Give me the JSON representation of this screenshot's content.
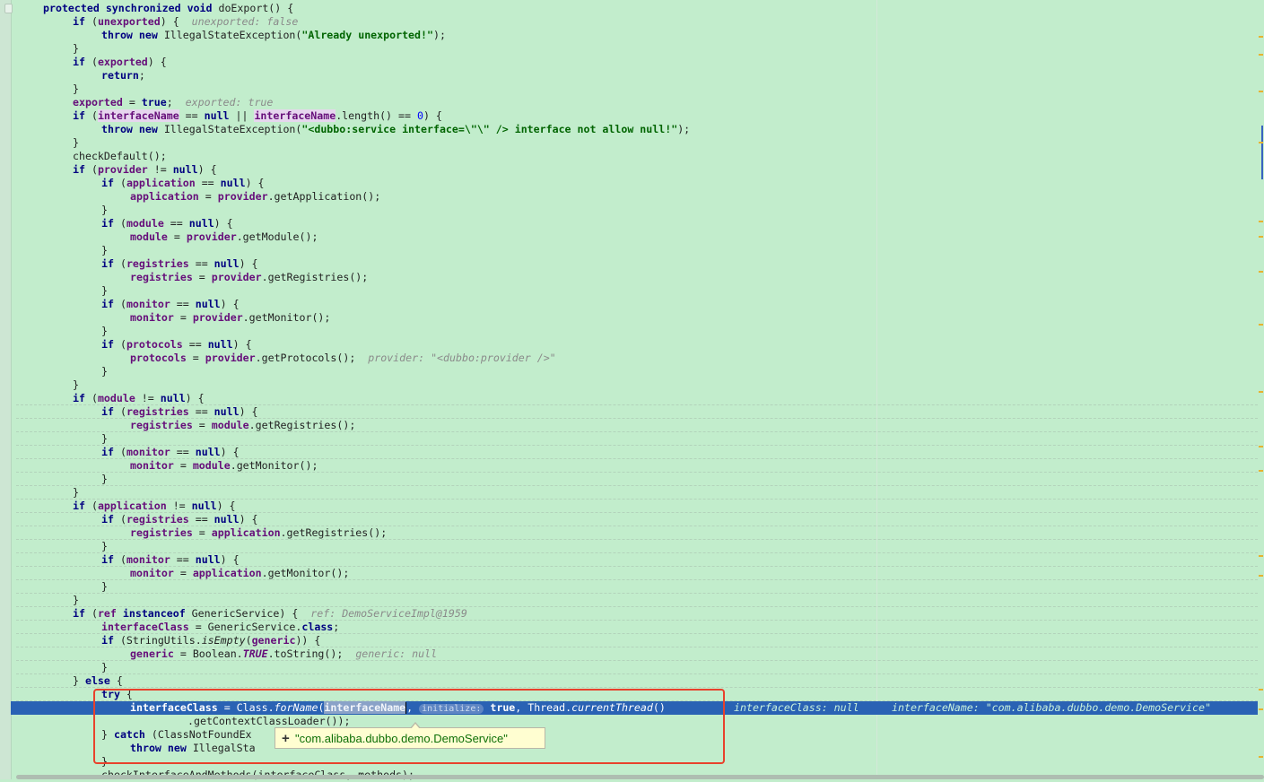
{
  "editor": {
    "lines": {
      "l01": [
        "protected",
        " ",
        "synchronized",
        " ",
        "void",
        " doExport() {"
      ],
      "l02": [
        "if",
        " (",
        "unexported",
        ") {  ",
        "unexported: false"
      ],
      "l03": [
        "throw",
        " ",
        "new",
        " IllegalStateException(",
        "\"Already unexported!\"",
        ");"
      ],
      "l04": [
        "}"
      ],
      "l05": [
        "if",
        " (",
        "exported",
        ") {"
      ],
      "l06": [
        "return",
        ";"
      ],
      "l07": [
        "}"
      ],
      "l08": [
        "exported",
        " = ",
        "true",
        ";  ",
        "exported: true"
      ],
      "l09": [
        "if",
        " (",
        "interfaceName",
        " == ",
        "null",
        " || ",
        "interfaceName",
        ".length() == ",
        "0",
        ") {"
      ],
      "l10": [
        "throw",
        " ",
        "new",
        " IllegalStateException(",
        "\"<dubbo:service interface=\\\"\\\" /> interface not allow null!\"",
        ");"
      ],
      "l11": [
        "}"
      ],
      "l12": [
        "checkDefault();"
      ],
      "l13": [
        "if",
        " (",
        "provider",
        " != ",
        "null",
        ") {"
      ],
      "l14": [
        "if",
        " (",
        "application",
        " == ",
        "null",
        ") {"
      ],
      "l15": [
        "application",
        " = ",
        "provider",
        ".getApplication();"
      ],
      "l16": [
        "}"
      ],
      "l17": [
        "if",
        " (",
        "module",
        " == ",
        "null",
        ") {"
      ],
      "l18": [
        "module",
        " = ",
        "provider",
        ".getModule();"
      ],
      "l19": [
        "}"
      ],
      "l20": [
        "if",
        " (",
        "registries",
        " == ",
        "null",
        ") {"
      ],
      "l21": [
        "registries",
        " = ",
        "provider",
        ".getRegistries();"
      ],
      "l22": [
        "}"
      ],
      "l23": [
        "if",
        " (",
        "monitor",
        " == ",
        "null",
        ") {"
      ],
      "l24": [
        "monitor",
        " = ",
        "provider",
        ".getMonitor();"
      ],
      "l25": [
        "}"
      ],
      "l26": [
        "if",
        " (",
        "protocols",
        " == ",
        "null",
        ") {"
      ],
      "l27": [
        "protocols",
        " = ",
        "provider",
        ".getProtocols();  ",
        "provider: \"<dubbo:provider />\""
      ],
      "l28": [
        "}"
      ],
      "l29": [
        "}"
      ],
      "l30": [
        "if",
        " (",
        "module",
        " != ",
        "null",
        ") {"
      ],
      "l31": [
        "if",
        " (",
        "registries",
        " == ",
        "null",
        ") {"
      ],
      "l32": [
        "registries",
        " = ",
        "module",
        ".getRegistries();"
      ],
      "l33": [
        "}"
      ],
      "l34": [
        "if",
        " (",
        "monitor",
        " == ",
        "null",
        ") {"
      ],
      "l35": [
        "monitor",
        " = ",
        "module",
        ".getMonitor();"
      ],
      "l36": [
        "}"
      ],
      "l37": [
        "}"
      ],
      "l38": [
        "if",
        " (",
        "application",
        " != ",
        "null",
        ") {"
      ],
      "l39": [
        "if",
        " (",
        "registries",
        " == ",
        "null",
        ") {"
      ],
      "l40": [
        "registries",
        " = ",
        "application",
        ".getRegistries();"
      ],
      "l41": [
        "}"
      ],
      "l42": [
        "if",
        " (",
        "monitor",
        " == ",
        "null",
        ") {"
      ],
      "l43": [
        "monitor",
        " = ",
        "application",
        ".getMonitor();"
      ],
      "l44": [
        "}"
      ],
      "l45": [
        "}"
      ],
      "l46": [
        "if",
        " (",
        "ref",
        " ",
        "instanceof",
        " GenericService) {  ",
        "ref: DemoServiceImpl@1959"
      ],
      "l47": [
        "interfaceClass",
        " = GenericService.",
        "class",
        ";"
      ],
      "l48": [
        "if",
        " (StringUtils.",
        "isEmpty",
        "(",
        "generic",
        ")) {"
      ],
      "l49": [
        "generic",
        " = Boolean.",
        "TRUE",
        ".toString();  ",
        "generic: null"
      ],
      "l50": [
        "}"
      ],
      "l51": [
        "}",
        " ",
        "else",
        " {"
      ],
      "l52": [
        "try",
        " {"
      ],
      "l53": [
        "interfaceClass",
        " = Class.",
        "forName",
        "(",
        "interfaceName",
        ", ",
        "initialize:",
        " ",
        "true",
        ", Thread.",
        "currentThread",
        "()",
        "interfaceClass: null",
        "interfaceName: \"com.alibaba.dubbo.demo.DemoService\""
      ],
      "l54": [
        ".getContextClassLoader());"
      ],
      "l55": [
        "}",
        " ",
        "catch",
        " (ClassNotFoundEx"
      ],
      "l56": [
        "throw",
        " ",
        "new",
        " IllegalSta"
      ],
      "l57": [
        "}"
      ],
      "l58": [
        "checkInterfaceAndMethods(interfaceClass, methods);"
      ]
    }
  },
  "tooltip": {
    "expand": "+",
    "value": "\"com.alibaba.dubbo.demo.DemoService\""
  },
  "colors": {
    "background": "#c2edcc",
    "execution_line": "#2a62b4",
    "annotation_border": "#e8422c",
    "tooltip_background": "#fffed1"
  }
}
